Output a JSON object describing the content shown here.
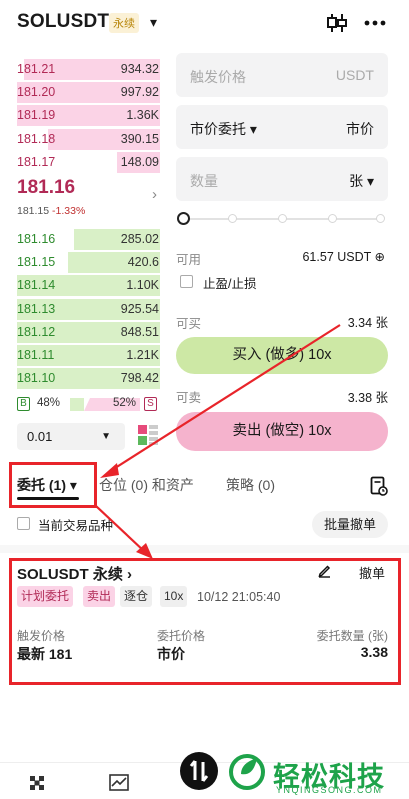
{
  "header": {
    "symbol": "SOLUSDT",
    "badge": "永续",
    "caret": "▾"
  },
  "orderbook": {
    "asks": [
      {
        "price": "181.21",
        "qty": "934.32",
        "depth": 0.95
      },
      {
        "price": "181.20",
        "qty": "997.92",
        "depth": 1.0
      },
      {
        "price": "181.19",
        "qty": "1.36K",
        "depth": 1.0
      },
      {
        "price": "181.18",
        "qty": "390.15",
        "depth": 0.78
      },
      {
        "price": "181.17",
        "qty": "148.09",
        "depth": 0.3
      }
    ],
    "last_price": "181.16",
    "mark_price": "181.15",
    "change_pct": "-1.33%",
    "bids": [
      {
        "price": "181.16",
        "qty": "285.02",
        "depth": 0.6
      },
      {
        "price": "181.15",
        "qty": "420.6",
        "depth": 0.64
      },
      {
        "price": "181.14",
        "qty": "1.10K",
        "depth": 1.0
      },
      {
        "price": "181.13",
        "qty": "925.54",
        "depth": 1.0
      },
      {
        "price": "181.12",
        "qty": "848.51",
        "depth": 1.0
      },
      {
        "price": "181.11",
        "qty": "1.21K",
        "depth": 1.0
      },
      {
        "price": "181.10",
        "qty": "798.42",
        "depth": 1.0
      }
    ],
    "buy_label": "B",
    "buy_ratio": "48%",
    "sell_ratio": "52%",
    "sell_label": "S",
    "depth_value": "0.01"
  },
  "form": {
    "trigger_placeholder": "触发价格",
    "trigger_unit": "USDT",
    "order_type": "市价委托 ▾",
    "price_mode": "市价",
    "qty_placeholder": "数量",
    "qty_unit": "张 ▾",
    "available_label": "可用",
    "available_value": "61.57 USDT ⊕",
    "tpsl_label": "止盈/止损",
    "can_buy_label": "可买",
    "can_buy_value": "3.34 张",
    "buy_button": "买入 (做多) 10x",
    "can_sell_label": "可卖",
    "can_sell_value": "3.38 张",
    "sell_button": "卖出 (做空) 10x",
    "slider_level": 0
  },
  "tabs": {
    "orders": "委托 (1) ▾",
    "positions": "仓位 (0) 和资产",
    "strategy": "策略 (0)"
  },
  "filter": {
    "current_pair": "当前交易品种",
    "cancel_all": "批量撤单"
  },
  "order": {
    "title": "SOLUSDT 永续 ›",
    "cancel": "撤单",
    "tags": [
      "计划委托",
      "卖出",
      "逐仓",
      "10x"
    ],
    "time": "10/12 21:05:40",
    "trigger_label": "触发价格",
    "trigger_value": "最新 181",
    "price_label": "委托价格",
    "price_value": "市价",
    "qty_label": "委托数量 (张)",
    "qty_value": "3.38"
  },
  "watermark": {
    "text": "轻松科技",
    "sub": "YNQINGSONG.COM"
  },
  "colors": {
    "ask": "#b12a56",
    "bid": "#2e8b2e",
    "buy_btn": "#cde8a5",
    "sell_btn": "#f5b3cd",
    "highlight": "#e8242a"
  }
}
